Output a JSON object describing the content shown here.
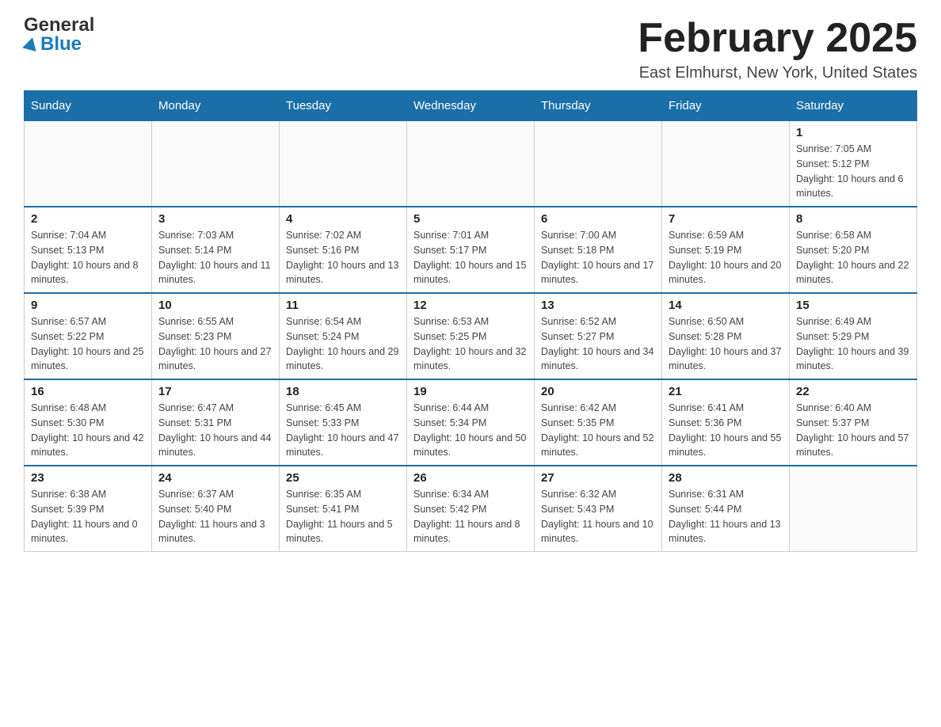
{
  "header": {
    "logo_general": "General",
    "logo_blue": "Blue",
    "month_title": "February 2025",
    "location": "East Elmhurst, New York, United States"
  },
  "days_of_week": [
    "Sunday",
    "Monday",
    "Tuesday",
    "Wednesday",
    "Thursday",
    "Friday",
    "Saturday"
  ],
  "weeks": [
    {
      "days": [
        {
          "number": "",
          "sunrise": "",
          "sunset": "",
          "daylight": "",
          "empty": true
        },
        {
          "number": "",
          "sunrise": "",
          "sunset": "",
          "daylight": "",
          "empty": true
        },
        {
          "number": "",
          "sunrise": "",
          "sunset": "",
          "daylight": "",
          "empty": true
        },
        {
          "number": "",
          "sunrise": "",
          "sunset": "",
          "daylight": "",
          "empty": true
        },
        {
          "number": "",
          "sunrise": "",
          "sunset": "",
          "daylight": "",
          "empty": true
        },
        {
          "number": "",
          "sunrise": "",
          "sunset": "",
          "daylight": "",
          "empty": true
        },
        {
          "number": "1",
          "sunrise": "Sunrise: 7:05 AM",
          "sunset": "Sunset: 5:12 PM",
          "daylight": "Daylight: 10 hours and 6 minutes.",
          "empty": false
        }
      ]
    },
    {
      "days": [
        {
          "number": "2",
          "sunrise": "Sunrise: 7:04 AM",
          "sunset": "Sunset: 5:13 PM",
          "daylight": "Daylight: 10 hours and 8 minutes.",
          "empty": false
        },
        {
          "number": "3",
          "sunrise": "Sunrise: 7:03 AM",
          "sunset": "Sunset: 5:14 PM",
          "daylight": "Daylight: 10 hours and 11 minutes.",
          "empty": false
        },
        {
          "number": "4",
          "sunrise": "Sunrise: 7:02 AM",
          "sunset": "Sunset: 5:16 PM",
          "daylight": "Daylight: 10 hours and 13 minutes.",
          "empty": false
        },
        {
          "number": "5",
          "sunrise": "Sunrise: 7:01 AM",
          "sunset": "Sunset: 5:17 PM",
          "daylight": "Daylight: 10 hours and 15 minutes.",
          "empty": false
        },
        {
          "number": "6",
          "sunrise": "Sunrise: 7:00 AM",
          "sunset": "Sunset: 5:18 PM",
          "daylight": "Daylight: 10 hours and 17 minutes.",
          "empty": false
        },
        {
          "number": "7",
          "sunrise": "Sunrise: 6:59 AM",
          "sunset": "Sunset: 5:19 PM",
          "daylight": "Daylight: 10 hours and 20 minutes.",
          "empty": false
        },
        {
          "number": "8",
          "sunrise": "Sunrise: 6:58 AM",
          "sunset": "Sunset: 5:20 PM",
          "daylight": "Daylight: 10 hours and 22 minutes.",
          "empty": false
        }
      ]
    },
    {
      "days": [
        {
          "number": "9",
          "sunrise": "Sunrise: 6:57 AM",
          "sunset": "Sunset: 5:22 PM",
          "daylight": "Daylight: 10 hours and 25 minutes.",
          "empty": false
        },
        {
          "number": "10",
          "sunrise": "Sunrise: 6:55 AM",
          "sunset": "Sunset: 5:23 PM",
          "daylight": "Daylight: 10 hours and 27 minutes.",
          "empty": false
        },
        {
          "number": "11",
          "sunrise": "Sunrise: 6:54 AM",
          "sunset": "Sunset: 5:24 PM",
          "daylight": "Daylight: 10 hours and 29 minutes.",
          "empty": false
        },
        {
          "number": "12",
          "sunrise": "Sunrise: 6:53 AM",
          "sunset": "Sunset: 5:25 PM",
          "daylight": "Daylight: 10 hours and 32 minutes.",
          "empty": false
        },
        {
          "number": "13",
          "sunrise": "Sunrise: 6:52 AM",
          "sunset": "Sunset: 5:27 PM",
          "daylight": "Daylight: 10 hours and 34 minutes.",
          "empty": false
        },
        {
          "number": "14",
          "sunrise": "Sunrise: 6:50 AM",
          "sunset": "Sunset: 5:28 PM",
          "daylight": "Daylight: 10 hours and 37 minutes.",
          "empty": false
        },
        {
          "number": "15",
          "sunrise": "Sunrise: 6:49 AM",
          "sunset": "Sunset: 5:29 PM",
          "daylight": "Daylight: 10 hours and 39 minutes.",
          "empty": false
        }
      ]
    },
    {
      "days": [
        {
          "number": "16",
          "sunrise": "Sunrise: 6:48 AM",
          "sunset": "Sunset: 5:30 PM",
          "daylight": "Daylight: 10 hours and 42 minutes.",
          "empty": false
        },
        {
          "number": "17",
          "sunrise": "Sunrise: 6:47 AM",
          "sunset": "Sunset: 5:31 PM",
          "daylight": "Daylight: 10 hours and 44 minutes.",
          "empty": false
        },
        {
          "number": "18",
          "sunrise": "Sunrise: 6:45 AM",
          "sunset": "Sunset: 5:33 PM",
          "daylight": "Daylight: 10 hours and 47 minutes.",
          "empty": false
        },
        {
          "number": "19",
          "sunrise": "Sunrise: 6:44 AM",
          "sunset": "Sunset: 5:34 PM",
          "daylight": "Daylight: 10 hours and 50 minutes.",
          "empty": false
        },
        {
          "number": "20",
          "sunrise": "Sunrise: 6:42 AM",
          "sunset": "Sunset: 5:35 PM",
          "daylight": "Daylight: 10 hours and 52 minutes.",
          "empty": false
        },
        {
          "number": "21",
          "sunrise": "Sunrise: 6:41 AM",
          "sunset": "Sunset: 5:36 PM",
          "daylight": "Daylight: 10 hours and 55 minutes.",
          "empty": false
        },
        {
          "number": "22",
          "sunrise": "Sunrise: 6:40 AM",
          "sunset": "Sunset: 5:37 PM",
          "daylight": "Daylight: 10 hours and 57 minutes.",
          "empty": false
        }
      ]
    },
    {
      "days": [
        {
          "number": "23",
          "sunrise": "Sunrise: 6:38 AM",
          "sunset": "Sunset: 5:39 PM",
          "daylight": "Daylight: 11 hours and 0 minutes.",
          "empty": false
        },
        {
          "number": "24",
          "sunrise": "Sunrise: 6:37 AM",
          "sunset": "Sunset: 5:40 PM",
          "daylight": "Daylight: 11 hours and 3 minutes.",
          "empty": false
        },
        {
          "number": "25",
          "sunrise": "Sunrise: 6:35 AM",
          "sunset": "Sunset: 5:41 PM",
          "daylight": "Daylight: 11 hours and 5 minutes.",
          "empty": false
        },
        {
          "number": "26",
          "sunrise": "Sunrise: 6:34 AM",
          "sunset": "Sunset: 5:42 PM",
          "daylight": "Daylight: 11 hours and 8 minutes.",
          "empty": false
        },
        {
          "number": "27",
          "sunrise": "Sunrise: 6:32 AM",
          "sunset": "Sunset: 5:43 PM",
          "daylight": "Daylight: 11 hours and 10 minutes.",
          "empty": false
        },
        {
          "number": "28",
          "sunrise": "Sunrise: 6:31 AM",
          "sunset": "Sunset: 5:44 PM",
          "daylight": "Daylight: 11 hours and 13 minutes.",
          "empty": false
        },
        {
          "number": "",
          "sunrise": "",
          "sunset": "",
          "daylight": "",
          "empty": true
        }
      ]
    }
  ]
}
